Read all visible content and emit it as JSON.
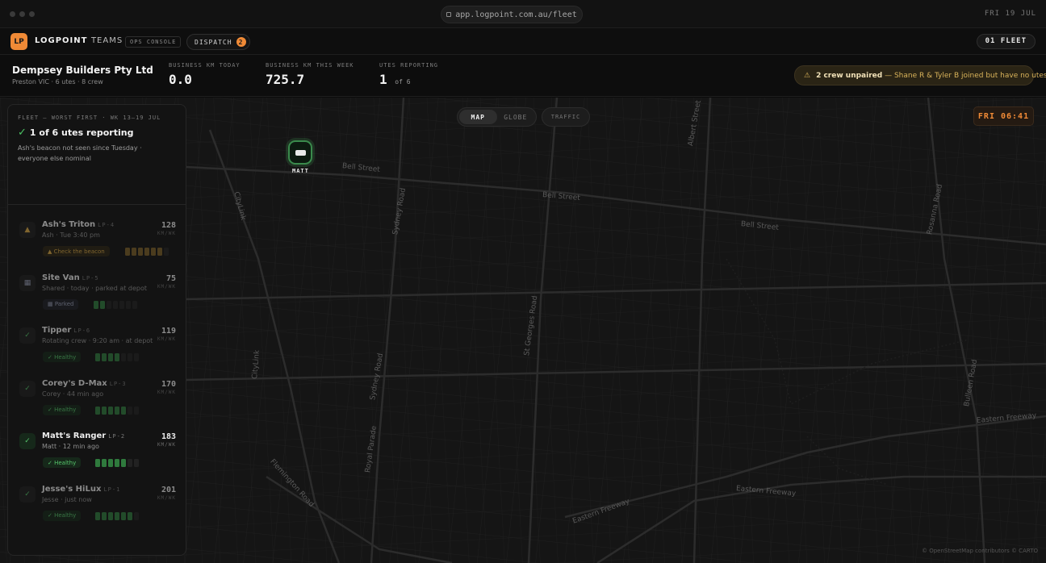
{
  "chrome": {
    "url": "app.logpoint.com.au/fleet",
    "date": "FRI 19 JUL"
  },
  "header": {
    "logo": "LP",
    "brand": "LOGPOINT",
    "brand_suffix": "TEAMS",
    "ops_console": "OPS CONSOLE",
    "dispatch_label": "DISPATCH",
    "dispatch_count": "2",
    "fleet_pill": "01 FLEET"
  },
  "summary": {
    "company": "Dempsey Builders Pty Ltd",
    "company_sub": "Preston VIC · 6 utes · 8 crew",
    "stats": [
      {
        "label": "BUSINESS KM TODAY",
        "value": "0.0",
        "suffix": ""
      },
      {
        "label": "BUSINESS KM THIS WEEK",
        "value": "725.7",
        "suffix": ""
      },
      {
        "label": "UTES REPORTING",
        "value": "1",
        "suffix": "of 6"
      }
    ],
    "alert_icon": "warning-icon",
    "alert_bold": "2 crew unpaired",
    "alert_text": "— Shane R & Tyler B joined but have no utes."
  },
  "map": {
    "toggle": [
      "MAP",
      "GLOBE"
    ],
    "traffic": "TRAFFIC",
    "clock": "FRI 06:41",
    "marker_label": "MATT",
    "attribution": "© OpenStreetMap contributors © CARTO",
    "streets": [
      "Bell Street",
      "Bell Street",
      "Bell Street",
      "Albert Street",
      "Sydney Road",
      "St Georges Road",
      "Sydney Road",
      "CityLink",
      "Royal Parade",
      "Flemington Road",
      "Eastern Freeway",
      "Eastern Freeway",
      "Eastern Freeway",
      "Rosanna Road",
      "Bulleen Road",
      "CityLink"
    ]
  },
  "panel": {
    "eyebrow": "FLEET — WORST FIRST · WK 13–19 JUL",
    "title": "1 of 6 utes reporting",
    "subtitle": "Ash's beacon not seen since Tuesday · everyone else nominal",
    "unit": "KM/WK",
    "utes": [
      {
        "name": "Ash's Triton",
        "reg": "LP-4",
        "sub": "Ash · Tue 3:40 pm",
        "km": "128",
        "status": "▲ Check the beacon",
        "icon": "▲",
        "bars": 6
      },
      {
        "name": "Site Van",
        "reg": "LP-5",
        "sub": "Shared · today · parked at depot",
        "km": "75",
        "status": "▦ Parked",
        "icon": "▦",
        "bars": 2
      },
      {
        "name": "Tipper",
        "reg": "LP-6",
        "sub": "Rotating crew · 9:20 am · at depot",
        "km": "119",
        "status": "✓ Healthy",
        "icon": "✓",
        "bars": 4
      },
      {
        "name": "Corey's D-Max",
        "reg": "LP-3",
        "sub": "Corey · 44 min ago",
        "km": "170",
        "status": "✓ Healthy",
        "icon": "✓",
        "bars": 5
      },
      {
        "name": "Matt's Ranger",
        "reg": "LP-2",
        "sub": "Matt · 12 min ago",
        "km": "183",
        "status": "✓ Healthy",
        "icon": "✓",
        "bars": 5
      },
      {
        "name": "Jesse's HiLux",
        "reg": "LP-1",
        "sub": "Jesse · just now",
        "km": "201",
        "status": "✓ Healthy",
        "icon": "✓",
        "bars": 6
      }
    ]
  }
}
